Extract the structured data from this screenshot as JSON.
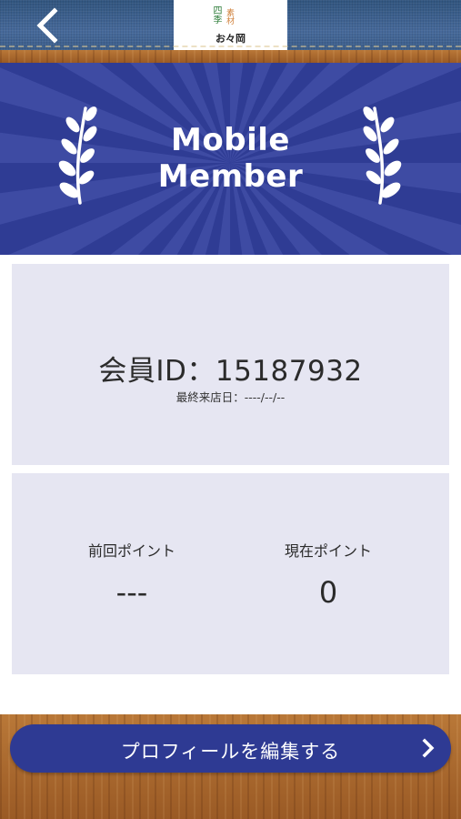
{
  "header": {
    "back_icon": "chevron-left-icon",
    "logo": {
      "season_text": "四季",
      "ingredient_text": "素材",
      "shop_name": "お々岡"
    }
  },
  "banner": {
    "title_line1": "Mobile",
    "title_line2": "Member",
    "decoration_icon": "laurel-branch-icon",
    "background_color": "#2f3c94"
  },
  "member": {
    "id_text": "会員ID：15187932",
    "last_visit_text": "最終来店日：----/--/--"
  },
  "points": {
    "previous": {
      "label": "前回ポイント",
      "value": "---"
    },
    "current": {
      "label": "現在ポイント",
      "value": "0"
    }
  },
  "actions": {
    "edit_profile_label": "プロフィールを編集する",
    "edit_profile_icon": "chevron-right-icon",
    "accent_color": "#2e3a93"
  }
}
